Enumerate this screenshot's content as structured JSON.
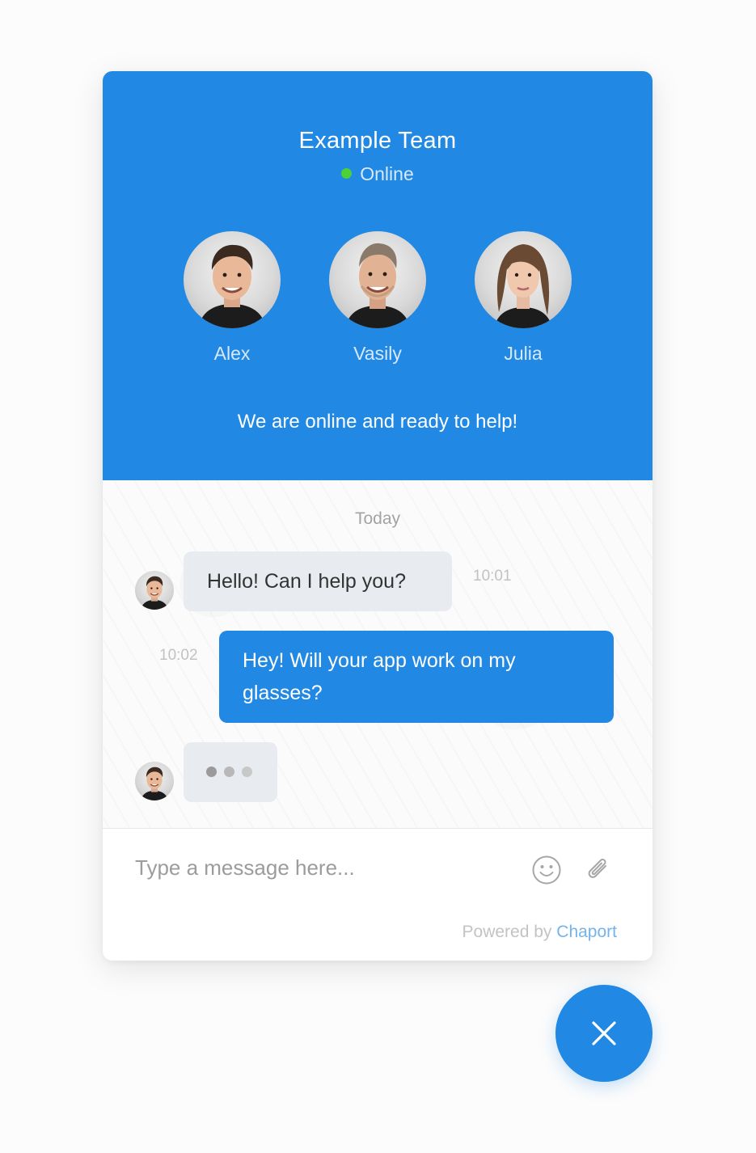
{
  "header": {
    "team_name": "Example Team",
    "status": "Online",
    "status_color": "#4cd137",
    "tagline": "We are online and ready to help!",
    "agents": [
      {
        "name": "Alex"
      },
      {
        "name": "Vasily"
      },
      {
        "name": "Julia"
      }
    ]
  },
  "chat": {
    "day_label": "Today",
    "messages": [
      {
        "direction": "incoming",
        "text": "Hello! Can I help you?",
        "time": "10:01"
      },
      {
        "direction": "outgoing",
        "text": "Hey! Will your app work on my glasses?",
        "time": "10:02"
      }
    ],
    "typing": true
  },
  "composer": {
    "placeholder": "Type a message here...",
    "icons": [
      "smiley-icon",
      "paperclip-icon"
    ]
  },
  "footer": {
    "powered_prefix": "Powered by",
    "powered_brand": "Chaport"
  },
  "colors": {
    "accent": "#2188e3",
    "incoming_bubble": "#e8ebef",
    "online": "#4cd137"
  },
  "close_button": {
    "icon": "close-icon"
  }
}
